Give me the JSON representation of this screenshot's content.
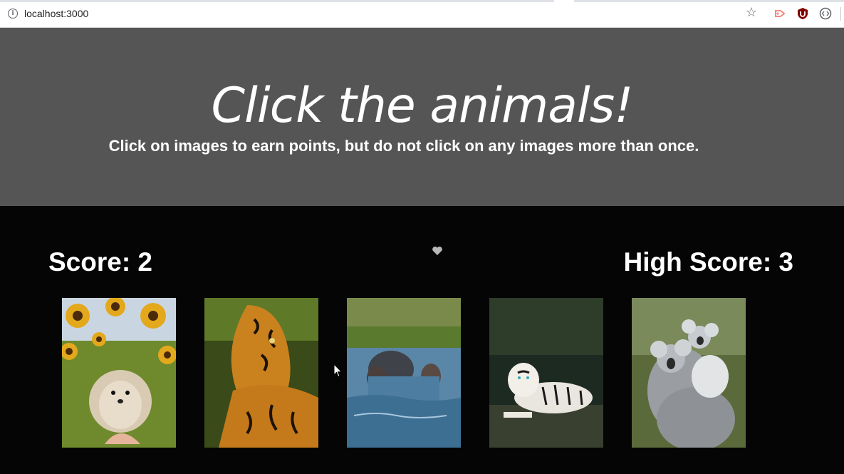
{
  "browser": {
    "url": "localhost:3000",
    "info_icon_glyph": "i",
    "star_icon_glyph": "☆"
  },
  "header": {
    "title": "Click the animals!",
    "subtitle": "Click on images to earn points, but do not click on any images more than once."
  },
  "game": {
    "score_label": "Score: 2",
    "high_score_label": "High Score: 3"
  },
  "cards": [
    {
      "name": "hedgehog",
      "icon": "hedgehog-image"
    },
    {
      "name": "tiger",
      "icon": "tiger-image"
    },
    {
      "name": "hippos",
      "icon": "hippo-image"
    },
    {
      "name": "white-tiger",
      "icon": "white-tiger-image"
    },
    {
      "name": "koalas",
      "icon": "koala-image"
    }
  ],
  "colors": {
    "header_bg": "#555555",
    "page_bg": "#050505",
    "text": "#ffffff"
  }
}
